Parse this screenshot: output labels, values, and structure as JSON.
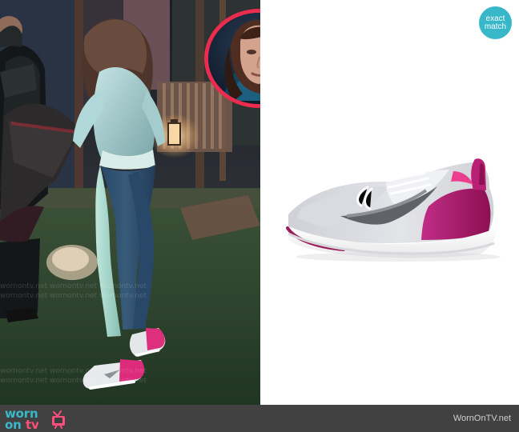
{
  "badge": {
    "line1": "exact",
    "line2": "match",
    "color": "#37b7c8"
  },
  "footer": {
    "logo": {
      "worn": "worn",
      "on": "on",
      "tv": "tv",
      "icon": "tv-icon"
    },
    "domain": "WornOnTV.net"
  },
  "colors": {
    "footer_bg": "#414141",
    "inset_ring": "#ec2c4e",
    "logo_teal": "#38b8c8",
    "logo_pink": "#ff4f7a"
  }
}
